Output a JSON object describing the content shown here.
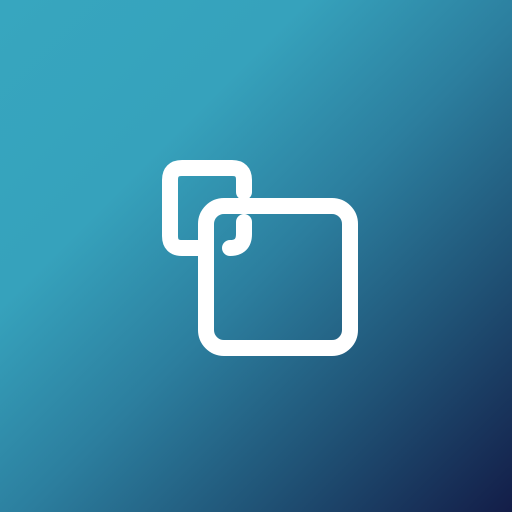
{
  "app_icon": {
    "icon": "copy-icon",
    "glyph_color": "#ffffff",
    "gradient_colors": [
      "#37a6bf",
      "#2c7f9f",
      "#205477",
      "#131d48"
    ]
  }
}
